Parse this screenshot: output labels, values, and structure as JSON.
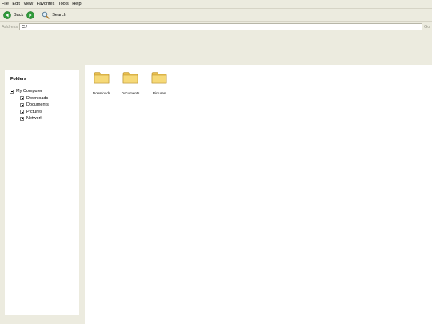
{
  "menu": [
    {
      "accel": "F",
      "rest": "ile"
    },
    {
      "accel": "E",
      "rest": "dit"
    },
    {
      "accel": "V",
      "rest": "iew"
    },
    {
      "accel": "F",
      "rest": "avorites"
    },
    {
      "accel": "T",
      "rest": "ools"
    },
    {
      "accel": "H",
      "rest": "elp"
    }
  ],
  "toolbar": {
    "back_label": "Back",
    "search_label": "Search",
    "back_icon": "back-arrow-icon",
    "forward_icon": "forward-arrow-icon",
    "search_icon": "magnifier-icon"
  },
  "address": {
    "label": "Address",
    "value": "C:/",
    "go_label": "Go"
  },
  "folders_pane": {
    "title": "Folders",
    "root": "My Computer",
    "children": [
      "Downloads",
      "Documents",
      "Pictures",
      "Network"
    ]
  },
  "content": {
    "items": [
      "Downloads",
      "Documents",
      "Pictures"
    ]
  },
  "colors": {
    "chrome": "#ecebdf",
    "nav_green": "#2f9a3a",
    "folder_yellow": "#f3d26a"
  }
}
